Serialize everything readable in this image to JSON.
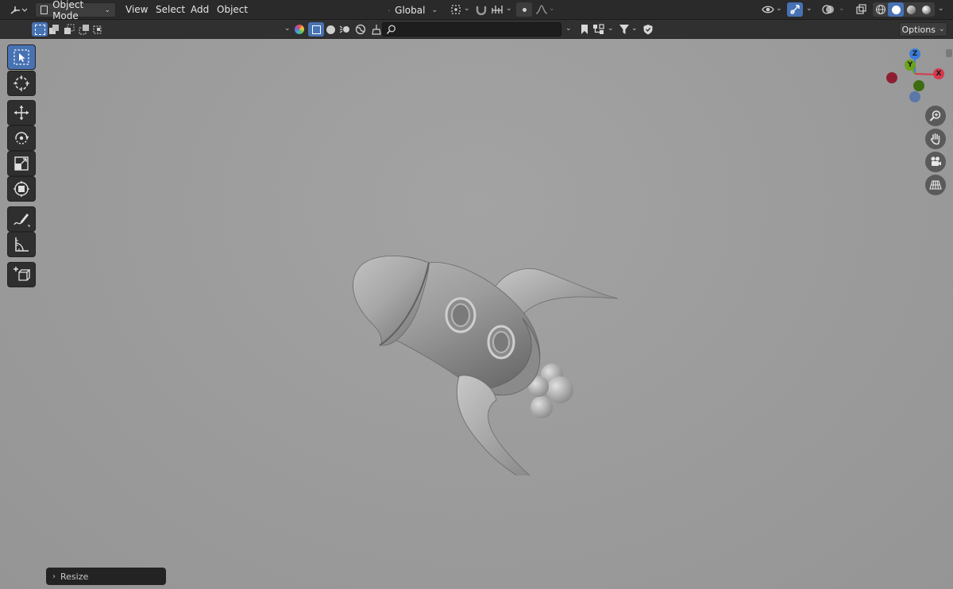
{
  "header": {
    "mode_label": "Object Mode",
    "menus": [
      "View",
      "Select",
      "Add",
      "Object"
    ],
    "transform_orientation": "Global"
  },
  "secondary": {
    "search_value": "",
    "options_label": "Options"
  },
  "viewport": {
    "gizmo_axes": [
      "Z",
      "Y",
      "X"
    ],
    "resize_panel_label": "Resize"
  },
  "colors": {
    "accent": "#4772b3",
    "axis_x": "#d8394b",
    "axis_y": "#6aa319",
    "axis_z": "#3b7dd8"
  }
}
